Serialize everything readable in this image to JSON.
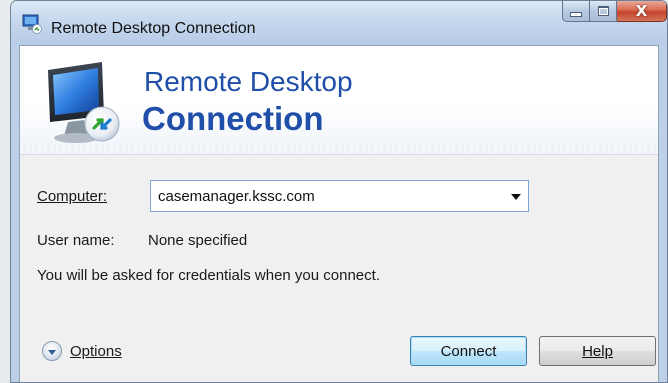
{
  "window": {
    "title": "Remote Desktop Connection",
    "minimize_icon": "minimize-icon",
    "maximize_icon": "maximize-icon",
    "close_icon": "close-icon",
    "close_glyph": "X"
  },
  "banner": {
    "line1": "Remote Desktop",
    "line2": "Connection",
    "logo_icon": "remote-desktop-monitor-icon"
  },
  "form": {
    "computer_label": "Computer:",
    "computer_value": "casemanager.kssc.com",
    "username_label": "User name:",
    "username_value": "None specified",
    "credentials_notice": "You will be asked for credentials when you connect."
  },
  "footer": {
    "options_label": "Options",
    "connect_label": "Connect",
    "help_label": "Help"
  },
  "colors": {
    "banner_text": "#1f4fa8",
    "close_button": "#c2432a",
    "connect_border": "#3c7fb1"
  }
}
